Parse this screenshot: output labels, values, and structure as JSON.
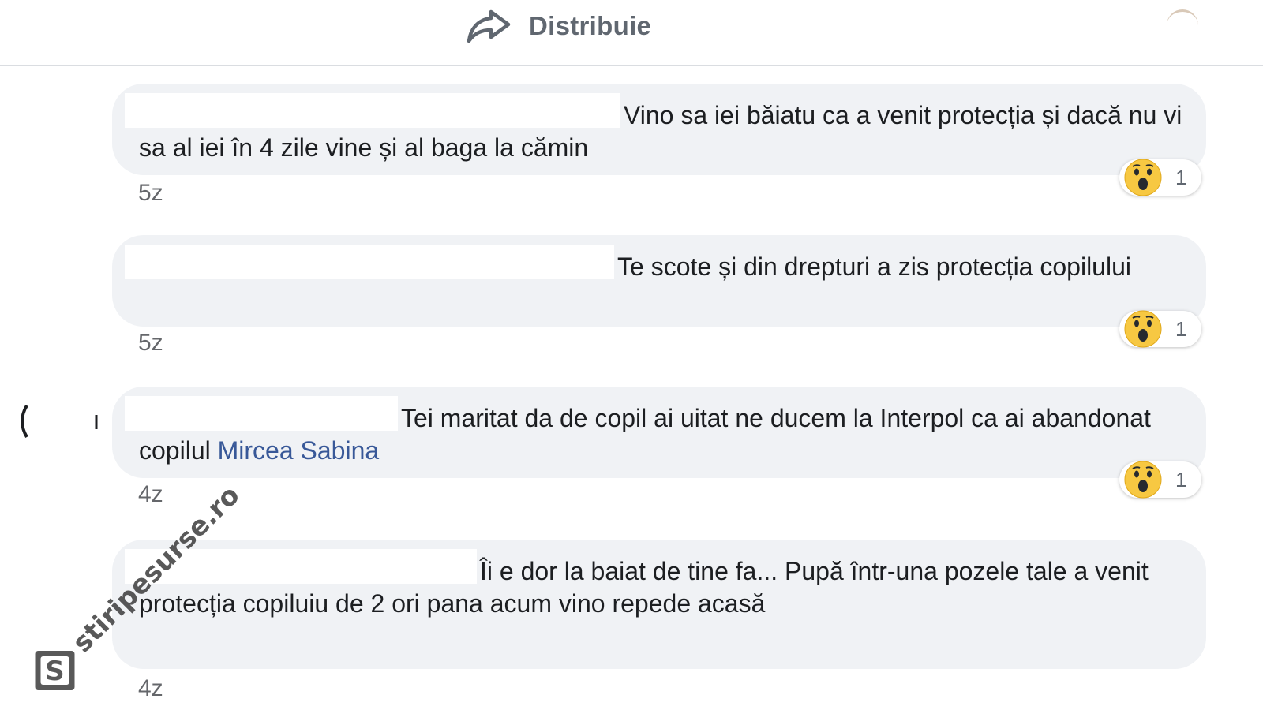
{
  "header": {
    "share_label": "Distribuie",
    "share_icon": "share-arrow-icon"
  },
  "comments": [
    {
      "text": "Vino sa iei băiatu ca a venit protecția și dacă nu vi sa al iei în 4 zile vine și al baga la cămin",
      "mention": "",
      "reaction_icon": "wow-emoji-icon",
      "reaction_count": "1",
      "timestamp": "5z"
    },
    {
      "text": "Te scote și din drepturi a zis protecția copilului",
      "mention": "",
      "reaction_icon": "wow-emoji-icon",
      "reaction_count": "1",
      "timestamp": "5z"
    },
    {
      "text": "Tei maritat da de copil ai uitat ne ducem la Interpol ca ai abandonat copilul ",
      "mention": "Mircea Sabina",
      "reaction_icon": "wow-emoji-icon",
      "reaction_count": "1",
      "timestamp": "4z"
    },
    {
      "text": "Îi e dor la baiat de tine fa... Pupă într-una pozele tale a venit protecția copiluiu de 2 ori pana acum vino repede acasă",
      "mention": "",
      "timestamp": "4z"
    }
  ],
  "watermark": {
    "text": "stiripesurse.ro",
    "logo_letter": "S"
  },
  "colors": {
    "bubble_bg": "#f0f2f5",
    "mention": "#385898",
    "muted_text": "#65676b",
    "wow_yellow": "#f7c842"
  }
}
